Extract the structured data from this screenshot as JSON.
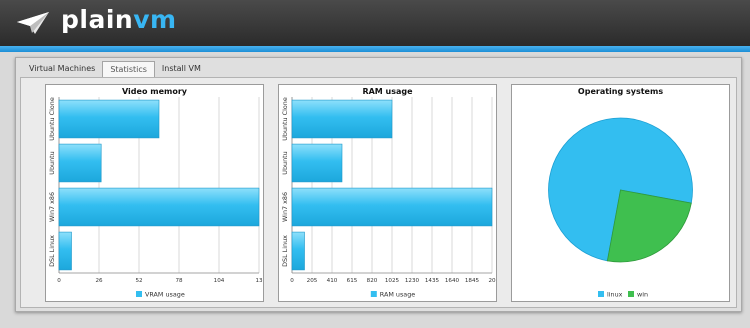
{
  "header": {
    "logo_part1": "plain",
    "logo_part2": "vm"
  },
  "tabs": [
    {
      "label": "Virtual Machines",
      "active": false
    },
    {
      "label": "Statistics",
      "active": true
    },
    {
      "label": "Install VM",
      "active": false
    }
  ],
  "colors": {
    "bar": "#33bef0",
    "bar_dark": "#1ca7dc",
    "linux": "#33bef0",
    "win": "#3fbf4f"
  },
  "chart_data": [
    {
      "type": "bar",
      "orientation": "horizontal",
      "title": "Video memory",
      "categories": [
        "Ubuntu Clone",
        "Ubuntu",
        "Win7 x86",
        "DSL Linux"
      ],
      "values": [
        64,
        27,
        128,
        8
      ],
      "xticks": [
        "0",
        "26",
        "52",
        "78",
        "104",
        "13"
      ],
      "xlim": [
        0,
        128
      ],
      "legend": "VRAM usage",
      "grid": true
    },
    {
      "type": "bar",
      "orientation": "horizontal",
      "title": "RAM usage",
      "categories": [
        "Ubuntu Clone",
        "Ubuntu",
        "Win7 x86",
        "DSL Linux"
      ],
      "values": [
        1024,
        512,
        2048,
        128
      ],
      "xticks": [
        "0",
        "205",
        "410",
        "615",
        "820",
        "1025",
        "1230",
        "1435",
        "1640",
        "1845",
        "20"
      ],
      "xlim": [
        0,
        2048
      ],
      "legend": "RAM usage",
      "grid": true
    },
    {
      "type": "pie",
      "title": "Operating systems",
      "labels": [
        "linux",
        "win"
      ],
      "values": [
        75,
        25
      ],
      "legend_position": "bottom"
    }
  ]
}
